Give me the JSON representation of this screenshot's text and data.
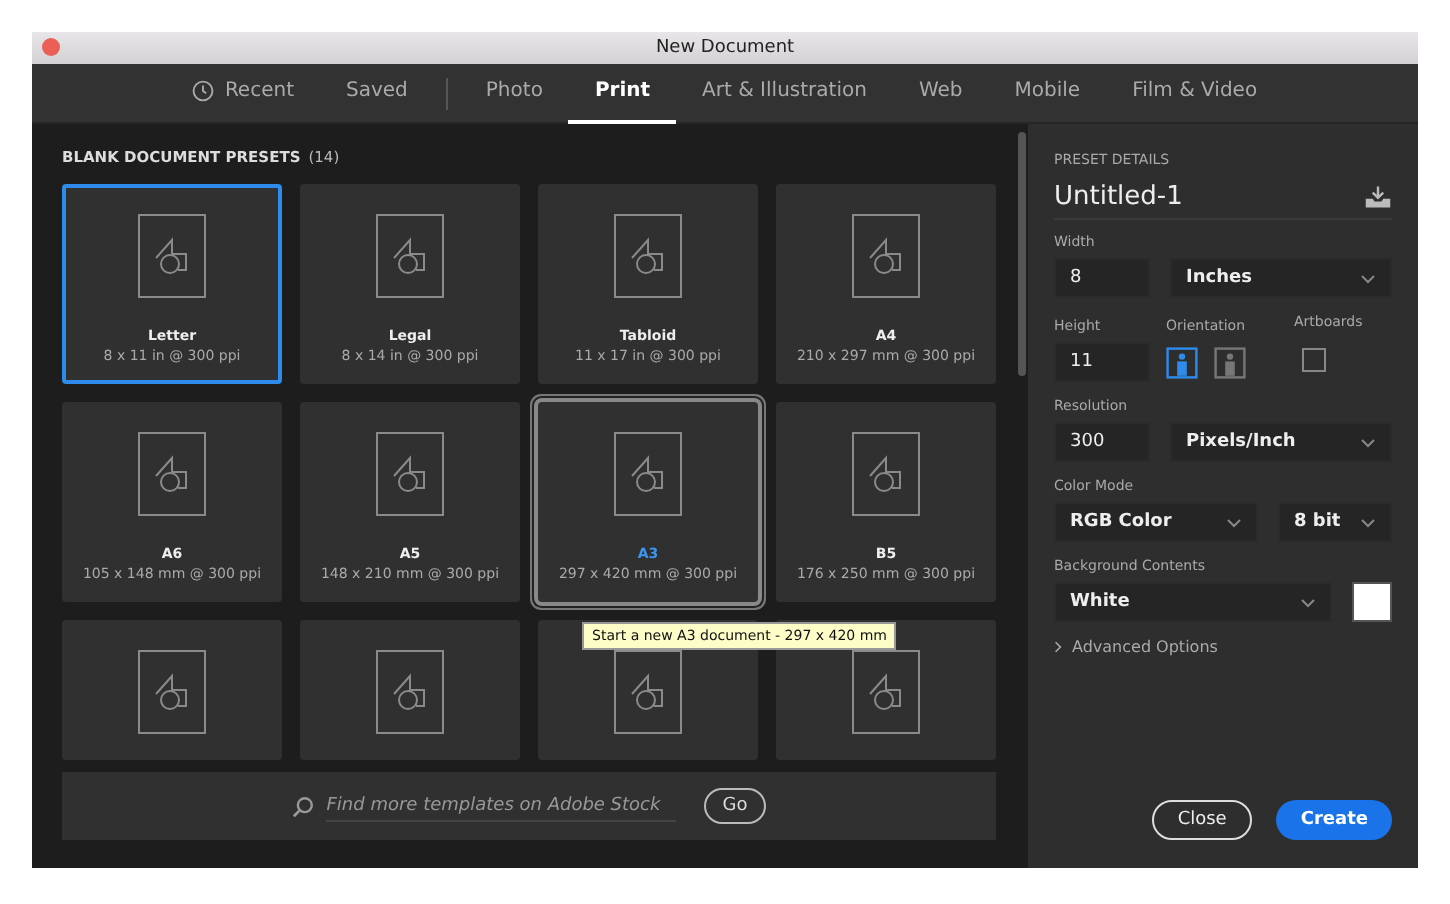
{
  "window": {
    "title": "New Document"
  },
  "tab_groups": [
    [
      {
        "label": "Recent",
        "selected": false
      },
      {
        "label": "Saved",
        "selected": false
      }
    ],
    [
      {
        "label": "Photo",
        "selected": false
      },
      {
        "label": "Print",
        "selected": true
      },
      {
        "label": "Art & Illustration",
        "selected": false
      },
      {
        "label": "Web",
        "selected": false
      },
      {
        "label": "Mobile",
        "selected": false
      },
      {
        "label": "Film & Video",
        "selected": false
      }
    ]
  ],
  "presets": {
    "heading": "BLANK DOCUMENT PRESETS",
    "count": "(14)",
    "items": [
      {
        "name": "Letter",
        "size": "8 x 11 in @ 300 ppi",
        "selected": true,
        "hovered": false
      },
      {
        "name": "Legal",
        "size": "8 x 14 in @ 300 ppi",
        "selected": false,
        "hovered": false
      },
      {
        "name": "Tabloid",
        "size": "11 x 17 in @ 300 ppi",
        "selected": false,
        "hovered": false
      },
      {
        "name": "A4",
        "size": "210 x 297 mm @ 300 ppi",
        "selected": false,
        "hovered": false
      },
      {
        "name": "A6",
        "size": "105 x 148 mm @ 300 ppi",
        "selected": false,
        "hovered": false
      },
      {
        "name": "A5",
        "size": "148 x 210 mm @ 300 ppi",
        "selected": false,
        "hovered": false
      },
      {
        "name": "A3",
        "size": "297 x 420 mm @ 300 ppi",
        "selected": false,
        "hovered": true
      },
      {
        "name": "B5",
        "size": "176 x 250 mm @ 300 ppi",
        "selected": false,
        "hovered": false
      },
      {
        "selected": false,
        "hovered": false
      },
      {
        "selected": false,
        "hovered": false
      },
      {
        "selected": false,
        "hovered": false
      },
      {
        "selected": false,
        "hovered": false
      }
    ]
  },
  "tooltip": "Start a new A3 document - 297 x 420 mm",
  "stock_search": {
    "placeholder": "Find more templates on Adobe Stock",
    "button": "Go"
  },
  "details": {
    "heading": "PRESET DETAILS",
    "name": "Untitled-1",
    "width": {
      "label": "Width",
      "value": "8",
      "unit": "Inches"
    },
    "height": {
      "label": "Height",
      "value": "11"
    },
    "orientation": {
      "label": "Orientation",
      "options": [
        {
          "selected": true
        },
        {
          "selected": false
        }
      ]
    },
    "artboards": {
      "label": "Artboards",
      "checked": false
    },
    "resolution": {
      "label": "Resolution",
      "value": "300",
      "unit": "Pixels/Inch"
    },
    "color_mode": {
      "label": "Color Mode",
      "mode": "RGB Color",
      "depth": "8 bit"
    },
    "background": {
      "label": "Background Contents",
      "value": "White",
      "color": "#ffffff"
    },
    "advanced": {
      "label": "Advanced Options",
      "expanded": false
    }
  },
  "buttons": {
    "close": "Close",
    "create": "Create"
  }
}
